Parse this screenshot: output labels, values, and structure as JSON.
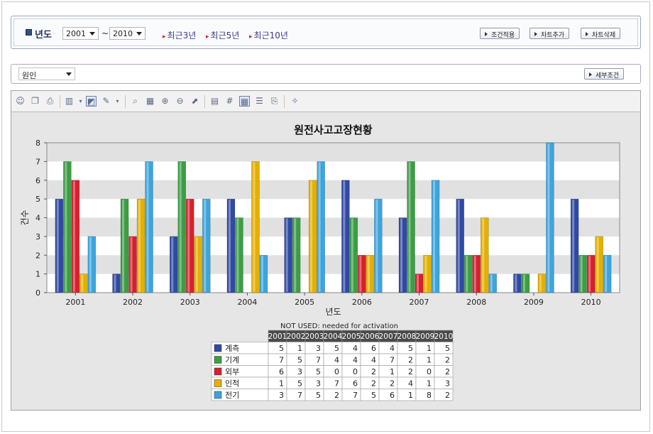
{
  "filter": {
    "year_label": "년도",
    "from_year": "2001",
    "range_sep": "~",
    "to_year": "2010",
    "quick_links": [
      "최근3년",
      "최근5년",
      "최근10년"
    ],
    "buttons": [
      "조건적용",
      "차트추가",
      "차트삭제"
    ]
  },
  "sub": {
    "category": "원인",
    "detail_button": "세부조건"
  },
  "colors": {
    "bg": "#e6e6e6",
    "plot_band_light": "#ffffff",
    "plot_band_dark": "#e1e1e1",
    "series": [
      "#2f49a4",
      "#3c9d45",
      "#d6202e",
      "#e4b000",
      "#3da4dc"
    ]
  },
  "toolbar_icons": [
    "people-icon",
    "copy-icon",
    "print-icon",
    "bar-chart-type-icon",
    "chart-area-icon",
    "paint-brush-icon",
    "zoom-icon",
    "grid-icon",
    "split-horizontal-icon",
    "split-vertical-icon",
    "export-icon",
    "chart-props-icon",
    "abc-labels-icon",
    "table-toggle-icon",
    "legend-icon",
    "preview-icon",
    "magic-wand-icon"
  ],
  "chart_data": {
    "type": "bar",
    "title": "원전사고고장현황",
    "xlabel": "년도",
    "ylabel": "건수",
    "ylim": [
      0,
      8
    ],
    "yticks": [
      0,
      1,
      2,
      3,
      4,
      5,
      6,
      7,
      8
    ],
    "categories": [
      "2001",
      "2002",
      "2003",
      "2004",
      "2005",
      "2006",
      "2007",
      "2008",
      "2009",
      "2010"
    ],
    "series": [
      {
        "name": "계측",
        "values": [
          5,
          1,
          3,
          5,
          4,
          6,
          4,
          5,
          1,
          5
        ]
      },
      {
        "name": "기계",
        "values": [
          7,
          5,
          7,
          4,
          4,
          4,
          7,
          2,
          1,
          2
        ]
      },
      {
        "name": "외부",
        "values": [
          6,
          3,
          5,
          0,
          0,
          2,
          1,
          2,
          0,
          2
        ]
      },
      {
        "name": "인적",
        "values": [
          1,
          5,
          3,
          7,
          6,
          2,
          2,
          4,
          1,
          3
        ]
      },
      {
        "name": "전기",
        "values": [
          3,
          7,
          5,
          2,
          7,
          5,
          6,
          1,
          8,
          2
        ]
      }
    ],
    "grid": "alternating horizontal bands",
    "legend": "data table below chart",
    "table_caption": "NOT USED: needed for activation"
  }
}
